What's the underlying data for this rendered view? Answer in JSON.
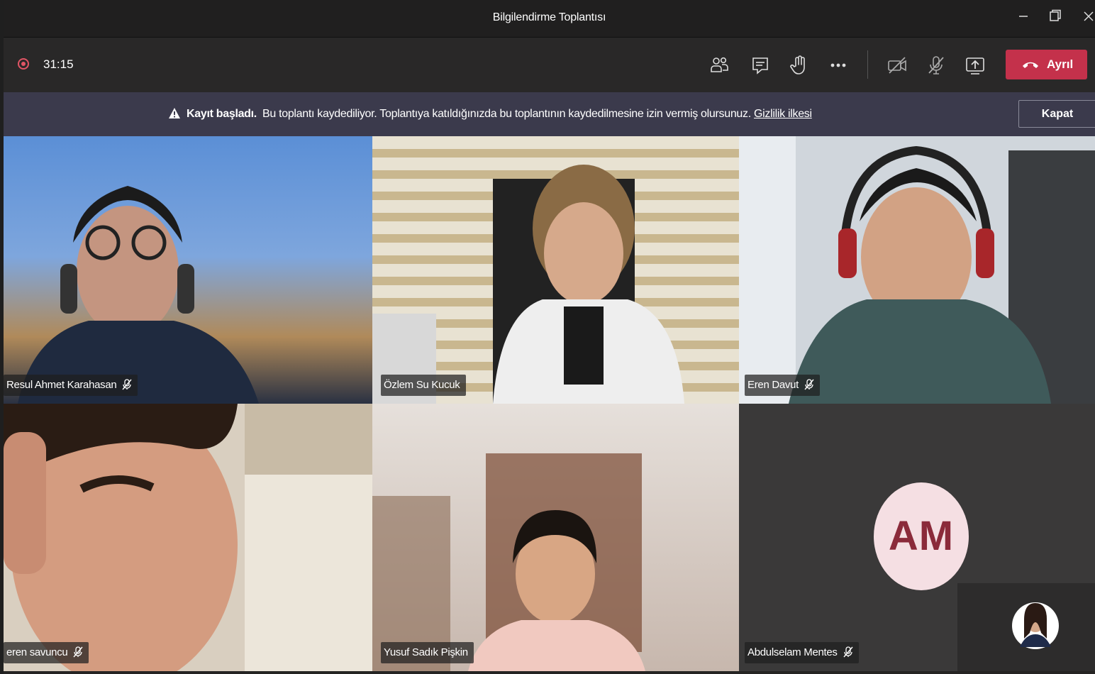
{
  "window": {
    "title": "Bilgilendirme Toplantısı",
    "minimize_icon": "minimize-icon",
    "restore_icon": "restore-icon",
    "close_icon": "close-icon"
  },
  "toolbar": {
    "recording_indicator": "recording-icon",
    "timer": "31:15",
    "participants_icon": "participants-icon",
    "chat_icon": "chat-icon",
    "raise_hand_icon": "raise-hand-icon",
    "more_icon": "more-options-icon",
    "camera_icon": "camera-off-icon",
    "mic_icon": "mic-muted-icon",
    "share_icon": "share-screen-icon",
    "leave_label": "Ayrıl"
  },
  "banner": {
    "bold": "Kayıt başladı.",
    "message": "Bu toplantı kaydediliyor. Toplantıya katıldığınızda bu toplantının kaydedilmesine izin vermiş olursunuz.",
    "link": "Gizlilik ilkesi",
    "close_label": "Kapat"
  },
  "participants": [
    {
      "name": "Resul Ahmet Karahasan",
      "muted": true
    },
    {
      "name": "Özlem Su Kucuk",
      "muted": false
    },
    {
      "name": "Eren Davut",
      "muted": true
    },
    {
      "name": "eren savuncu",
      "muted": true
    },
    {
      "name": "Yusuf Sadık Pişkin",
      "muted": false
    },
    {
      "name": "Abdulselam Mentes",
      "muted": true,
      "initials": "AM"
    }
  ],
  "colors": {
    "leave": "#c4314b",
    "banner": "#3b3a4c",
    "avatar_bg": "#f5dfe3",
    "avatar_text": "#8b2a3a",
    "recording": "#e05565"
  }
}
